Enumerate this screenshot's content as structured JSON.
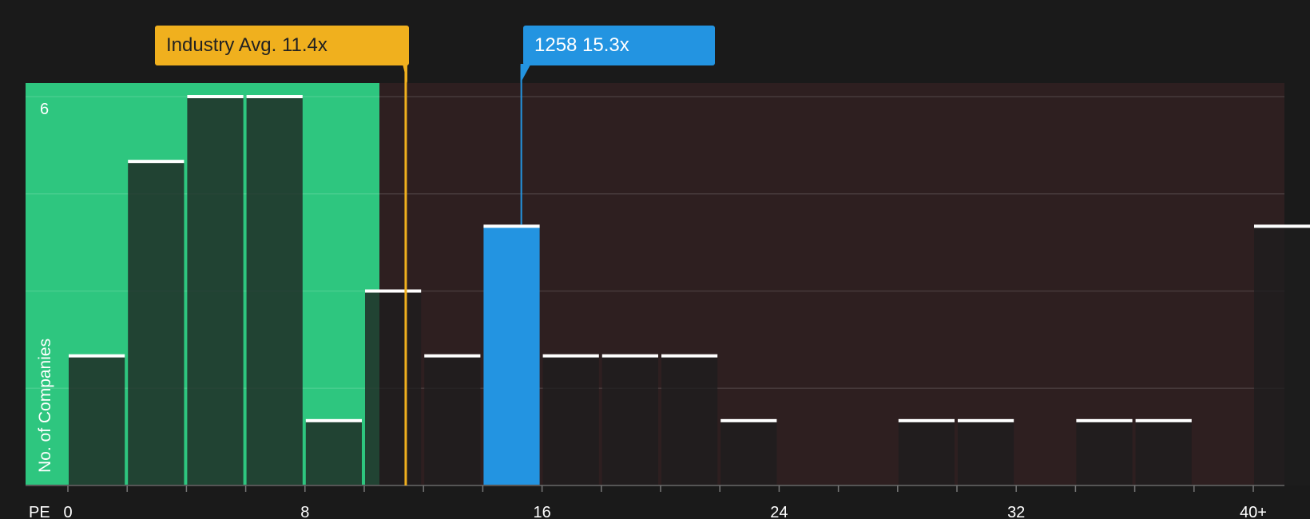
{
  "chart_data": {
    "type": "bar",
    "title": "",
    "xlabel": "PE",
    "ylabel": "No. of Companies",
    "x_ticks": [
      "0",
      "8",
      "16",
      "24",
      "32",
      "40+"
    ],
    "y_ticks": [
      "6"
    ],
    "ylim": [
      0,
      6
    ],
    "bin_width": 2,
    "bins": [
      {
        "start": 0,
        "count": 2
      },
      {
        "start": 2,
        "count": 5
      },
      {
        "start": 4,
        "count": 6
      },
      {
        "start": 6,
        "count": 6
      },
      {
        "start": 8,
        "count": 1
      },
      {
        "start": 10,
        "count": 3
      },
      {
        "start": 12,
        "count": 2
      },
      {
        "start": 14,
        "count": 4,
        "highlight": true
      },
      {
        "start": 16,
        "count": 2
      },
      {
        "start": 18,
        "count": 2
      },
      {
        "start": 20,
        "count": 2
      },
      {
        "start": 22,
        "count": 1
      },
      {
        "start": 28,
        "count": 1
      },
      {
        "start": 30,
        "count": 1
      },
      {
        "start": 34,
        "count": 1
      },
      {
        "start": 36,
        "count": 1
      },
      {
        "start": 40,
        "count": 4
      }
    ],
    "industry_avg": {
      "value": 11.4,
      "label": "Industry Avg. 11.4x"
    },
    "company": {
      "value": 15.3,
      "label": "1258 15.3x"
    },
    "grid": true,
    "colors": {
      "background": "#1a1a1a",
      "undervalued_zone": "#2ec67f",
      "overvalued_zone": "#2e1f20",
      "bar": "#222222",
      "bar_top": "#ffffff",
      "highlight_bar": "#2394e1",
      "industry_line": "#f0b01e",
      "company_line": "#2394e1"
    }
  }
}
